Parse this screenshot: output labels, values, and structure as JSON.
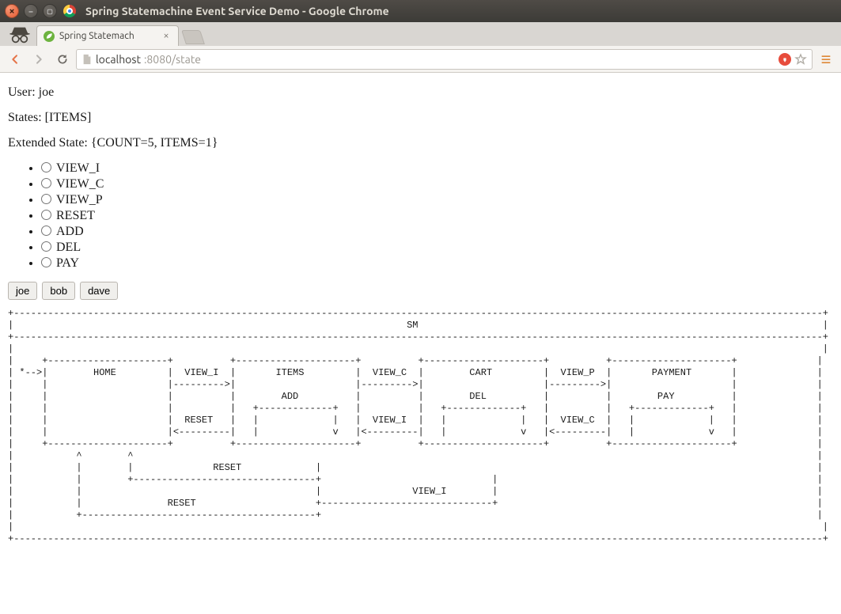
{
  "window": {
    "title": "Spring Statemachine Event Service Demo - Google Chrome"
  },
  "tab": {
    "title": "Spring Statemach"
  },
  "address": {
    "host": "localhost",
    "port_path": ":8080/state"
  },
  "content": {
    "user_label": "User: ",
    "user_value": "joe",
    "states_label": "States: ",
    "states_value": "[ITEMS]",
    "ext_label": "Extended State: ",
    "ext_value": "{COUNT=5, ITEMS=1}",
    "radios": [
      "VIEW_I",
      "VIEW_C",
      "VIEW_P",
      "RESET",
      "ADD",
      "DEL",
      "PAY"
    ],
    "buttons": [
      "joe",
      "bob",
      "dave"
    ],
    "ascii": "+----------------------------------------------------------------------------------------------------------------------------------------------+\n|                                                                     SM                                                                       |\n+----------------------------------------------------------------------------------------------------------------------------------------------+\n|                                                                                                                                              |\n|     +---------------------+          +---------------------+          +---------------------+          +---------------------+              |\n| *-->|        HOME         |  VIEW_I  |       ITEMS         |  VIEW_C  |        CART         |  VIEW_P  |       PAYMENT       |              |\n|     |                     |--------->|                     |--------->|                     |--------->|                     |              |\n|     |                     |          |        ADD          |          |        DEL          |          |        PAY          |              |\n|     |                     |          |   +-------------+   |          |   +-------------+   |          |   +-------------+   |              |\n|     |                     |  RESET   |   |             |   |  VIEW_I  |   |             |   |  VIEW_C  |   |             |   |              |\n|     |                     |<---------|   |             v   |<---------|   |             v   |<---------|   |             v   |              |\n|     +---------------------+          +---------------------+          +---------------------+          +---------------------+              |\n|           ^        ^                                                                                                                        |\n|           |        |              RESET             |                                                                                       |\n|           |        +--------------------------------+                              |                                                        |\n|           |                                         |                VIEW_I        |                                                        |\n|           |               RESET                     +------------------------------+                                                        |\n|           +-----------------------------------------+                                                                                       |\n|                                                                                                                                              |\n+----------------------------------------------------------------------------------------------------------------------------------------------+"
  }
}
